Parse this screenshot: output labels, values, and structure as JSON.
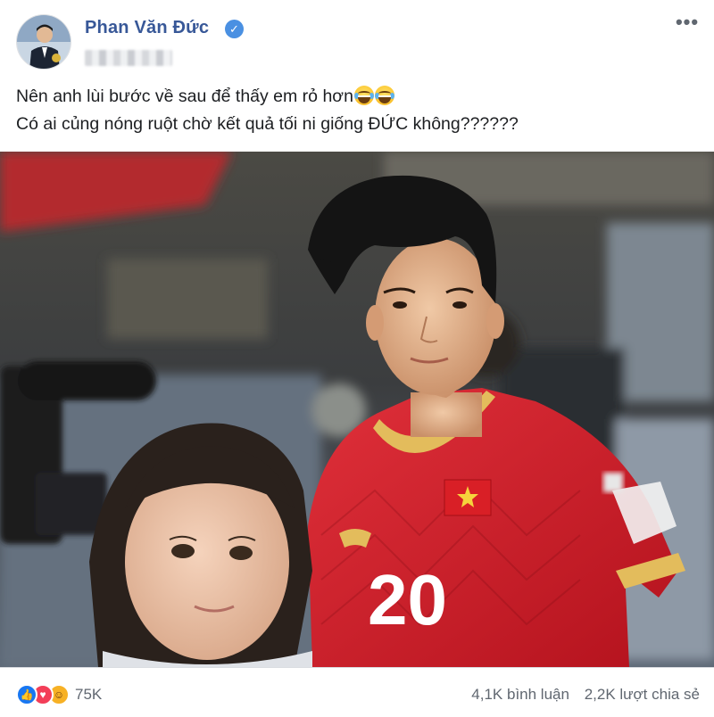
{
  "post": {
    "author": {
      "name": "Phan Văn Đức",
      "verified": true,
      "avatar": "author-avatar"
    },
    "more_icon": "more-options-icon",
    "text_lines": [
      "Nên anh lùi bước về sau để thấy em rỏ hơn",
      "Có ai củng nóng ruột chờ kết quả tối ni giống ĐỨC không??????"
    ],
    "emojis_line_1": [
      "laughing-tears-emoji",
      "laughing-tears-emoji"
    ],
    "photo": {
      "jersey_number": "20",
      "subject": "player-in-red-jersey"
    }
  },
  "engagement": {
    "reaction_icons": [
      "like-icon",
      "love-icon",
      "haha-icon"
    ],
    "reactions_count": "75K",
    "comments": "4,1K bình luận",
    "shares": "2,2K lượt chia sẻ"
  },
  "colors": {
    "author_name": "#385898",
    "verified_badge": "#4a90e2",
    "like": "#1877f2",
    "love": "#f33e58",
    "haha": "#f7b125",
    "jersey_red": "#d0222b"
  }
}
